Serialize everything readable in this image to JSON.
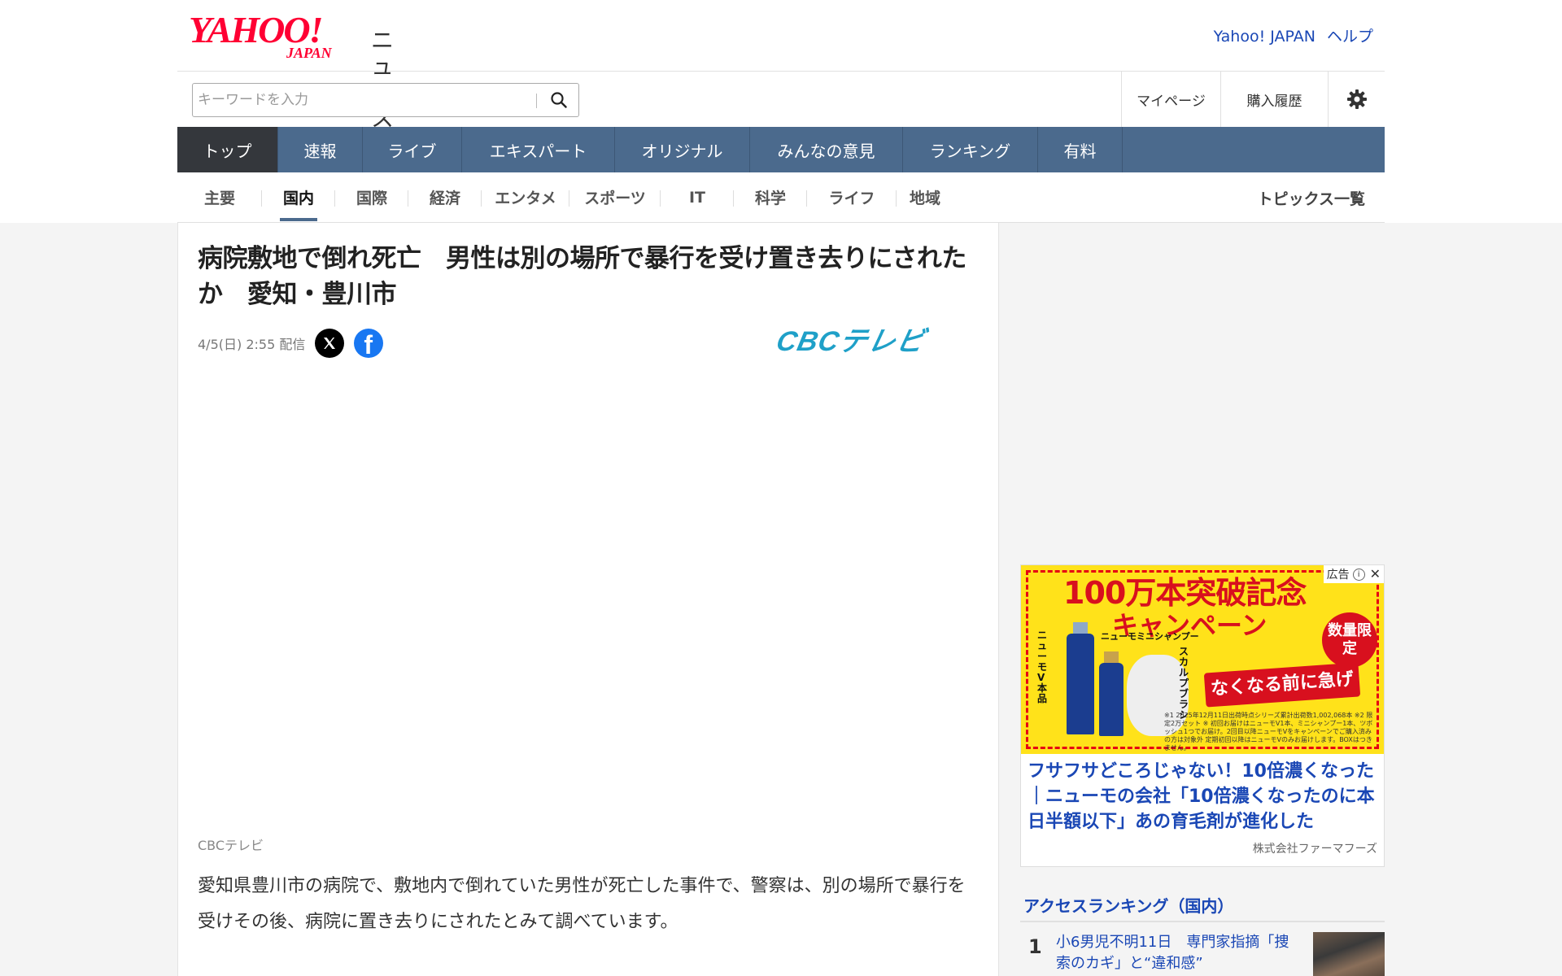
{
  "header": {
    "logo_yahoo": "YAHOO!",
    "logo_japan": "JAPAN",
    "logo_news": "ニュース",
    "link_yahoo_japan": "Yahoo! JAPAN",
    "link_help": "ヘルプ"
  },
  "search": {
    "placeholder": "キーワードを入力",
    "value": ""
  },
  "user_links": {
    "mypage": "マイページ",
    "history": "購入履歴"
  },
  "main_nav": [
    {
      "label": "トップ",
      "active": true
    },
    {
      "label": "速報"
    },
    {
      "label": "ライブ"
    },
    {
      "label": "エキスパート"
    },
    {
      "label": "オリジナル"
    },
    {
      "label": "みんなの意見"
    },
    {
      "label": "ランキング"
    },
    {
      "label": "有料"
    }
  ],
  "sub_nav": [
    {
      "label": "主要"
    },
    {
      "label": "国内",
      "active": true
    },
    {
      "label": "国際"
    },
    {
      "label": "経済"
    },
    {
      "label": "エンタメ"
    },
    {
      "label": "スポーツ"
    },
    {
      "label": "IT"
    },
    {
      "label": "科学"
    },
    {
      "label": "ライフ"
    },
    {
      "label": "地域"
    }
  ],
  "topics_link": "トピックス一覧",
  "article": {
    "title": "病院敷地で倒れ死亡　男性は別の場所で暴行を受け置き去りにされたか　愛知・豊川市",
    "date": "4/5(日) 2:55 配信",
    "source_logo": "CBCテレビ",
    "caption": "CBCテレビ",
    "body": "愛知県豊川市の病院で、敷地内で倒れていた男性が死亡した事件で、警察は、別の場所で暴行を受けその後、病院に置き去りにされたとみて調べています。"
  },
  "ad": {
    "label": "広告",
    "headline1": "100万本突破記念",
    "headline2": "キャンペーン",
    "badge": "数量限定",
    "product1": "ニューモV本品",
    "product2": "ニューモミニシャンプー",
    "product3": "スカルプブラシ",
    "cta": "なくなる前に急げ",
    "fine_print": "※1 2025年12月11日出荷時点シリーズ累計出荷数1,002,068本 ※2 限定2万セット ※ 初回お届けはニューモV1本、ミニシャンプー1本、ツボッシュ1つでお届け。2回目以降ニューモVをキャンペーンでご購入済みの方は対象外 定期初回以降はニューモVのみお届けします。BOXはつきません。",
    "title": "フサフサどころじゃない！10倍濃くなった｜ニューモの会社「10倍濃くなったのに本日半額以下」あの育毛剤が進化した",
    "sponsor": "株式会社ファーマフーズ"
  },
  "ranking": {
    "heading": "アクセスランキング（国内）",
    "items": [
      {
        "rank": "1",
        "text": "小6男児不明11日　専門家指摘「捜索のカギ」と“違和感”"
      }
    ]
  },
  "colors": {
    "accent_blue": "#1a47b5",
    "nav_bg": "#4b6a8d",
    "nav_active": "#34373c",
    "yahoo_red": "#ff0033",
    "cbc_cyan": "#1fa0c8"
  }
}
